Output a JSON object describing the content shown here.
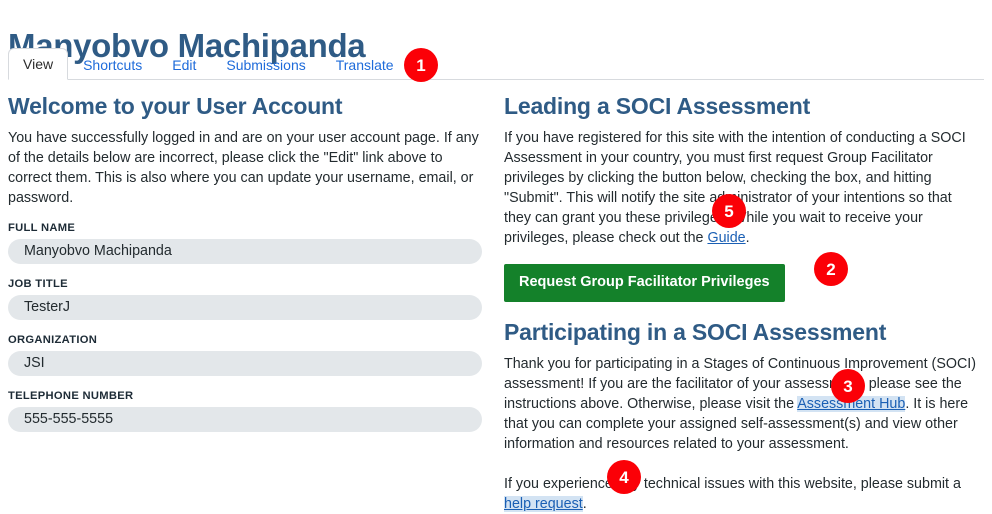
{
  "page": {
    "title": "Manyobvo Machipanda"
  },
  "tabs": [
    {
      "label": "View",
      "active": true
    },
    {
      "label": "Shortcuts",
      "active": false
    },
    {
      "label": "Edit",
      "active": false
    },
    {
      "label": "Submissions",
      "active": false
    },
    {
      "label": "Translate",
      "active": false
    }
  ],
  "left": {
    "heading": "Welcome to your User Account",
    "intro": "You have successfully logged in and are on your user account page. If any of the details below are incorrect, please click the \"Edit\" link above to correct them. This is also where you can update your username, email, or password.",
    "fields": [
      {
        "label": "Full Name",
        "value": "Manyobvo Machipanda"
      },
      {
        "label": "Job Title",
        "value": "TesterJ"
      },
      {
        "label": "Organization",
        "value": "JSI"
      },
      {
        "label": "Telephone Number",
        "value": "555-555-5555"
      }
    ]
  },
  "right": {
    "leading": {
      "heading": "Leading a SOCI Assessment",
      "paragraph_before_link": "If you have registered for this site with the intention of conducting a SOCI Assessment in your country, you must first request Group Facilitator privileges by clicking the button below, checking the box, and hitting \"Submit\". This will notify the site administrator of your intentions so that they can grant you these privileges. While you wait to receive your privileges, please check out the ",
      "link_text": "Guide",
      "paragraph_after_link": ".",
      "button_label": "Request Group Facilitator Privileges"
    },
    "participating": {
      "heading": "Participating in a SOCI Assessment",
      "paragraph_before_link": "Thank you for participating in a Stages of Continuous Improvement (SOCI) assessment! If you are the facilitator of your assessment, please see the instructions above. Otherwise, please visit the ",
      "link_text": "Assessment Hub",
      "paragraph_after_link": ". It is here that you can complete your assigned self-assessment(s) and view other information and resources related to your assessment."
    },
    "support": {
      "paragraph_before_link": "If you experience any technical issues with this website, please submit a ",
      "link_text": "help request",
      "paragraph_after_link": "."
    }
  },
  "badges": [
    {
      "id": "badge-1",
      "label": "1"
    },
    {
      "id": "badge-2",
      "label": "2"
    },
    {
      "id": "badge-3",
      "label": "3"
    },
    {
      "id": "badge-4",
      "label": "4"
    },
    {
      "id": "badge-5",
      "label": "5"
    }
  ],
  "colors": {
    "heading": "#2f5b85",
    "link": "#1a5fb4",
    "tab_link": "#1e6bda",
    "button_green": "#14812a",
    "badge_red": "#fb0007",
    "field_bg": "#e3e7ea"
  }
}
